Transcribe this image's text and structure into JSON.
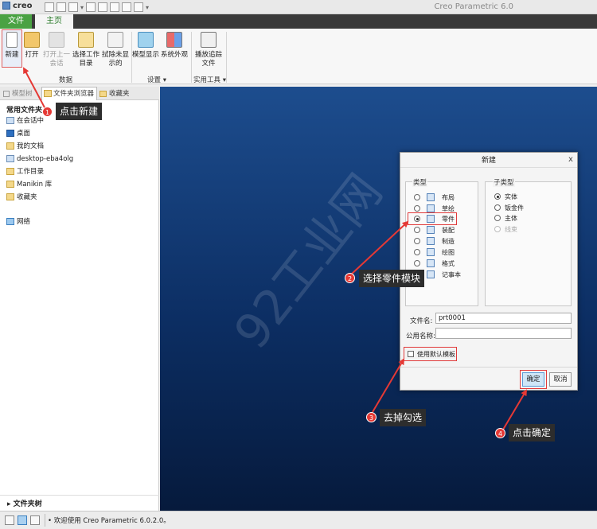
{
  "app": {
    "logo_text": "creo",
    "title": "Creo Parametric 6.0"
  },
  "ribbon_tabs": [
    "文件",
    "主页"
  ],
  "ribbon": {
    "new": "新建",
    "open": "打开",
    "open_last": "打开上一会话",
    "select_workdir": "选择工作目录",
    "erase_undisplayed": "拭除未显示的",
    "model_display": "模型显示",
    "system_appearance": "系统外观",
    "play_trail": "播放追踪文件",
    "group_data": "数据",
    "group_settings": "设置",
    "group_utilities": "实用工具"
  },
  "left_tabs": [
    "模型树",
    "文件夹浏览器",
    "收藏夹"
  ],
  "left_panel": {
    "title": "常用文件夹",
    "items": [
      "在会话中",
      "桌面",
      "我的文档",
      "desktop-eba4olg",
      "工作目录",
      "Manikin 库",
      "收藏夹"
    ],
    "network": "网络",
    "footer": "文件夹树"
  },
  "dialog": {
    "title": "新建",
    "close": "x",
    "type_group": "类型",
    "subtype_group": "子类型",
    "types": [
      "布局",
      "草绘",
      "零件",
      "装配",
      "制造",
      "绘图",
      "格式",
      "记事本"
    ],
    "selected_type": "零件",
    "subtypes": [
      "实体",
      "钣金件",
      "主体",
      "线束"
    ],
    "selected_subtype": "实体",
    "file_name_label": "文件名:",
    "file_name_value": "prt0001",
    "common_name_label": "公用名称:",
    "common_name_value": "",
    "use_default_template": "使用默认模板",
    "ok": "确定",
    "cancel": "取消"
  },
  "annotations": [
    {
      "num": "1",
      "text": "点击新建"
    },
    {
      "num": "2",
      "text": "选择零件模块"
    },
    {
      "num": "3",
      "text": "去掉勾选"
    },
    {
      "num": "4",
      "text": "点击确定"
    }
  ],
  "watermark": "92工业网",
  "status": {
    "message": "欢迎使用 Creo Parametric 6.0.2.0。"
  },
  "colors": {
    "accent_green": "#4aa243",
    "highlight_red": "#e03a3a",
    "canvas_top": "#1d4d8e",
    "canvas_bottom": "#061a3c"
  }
}
